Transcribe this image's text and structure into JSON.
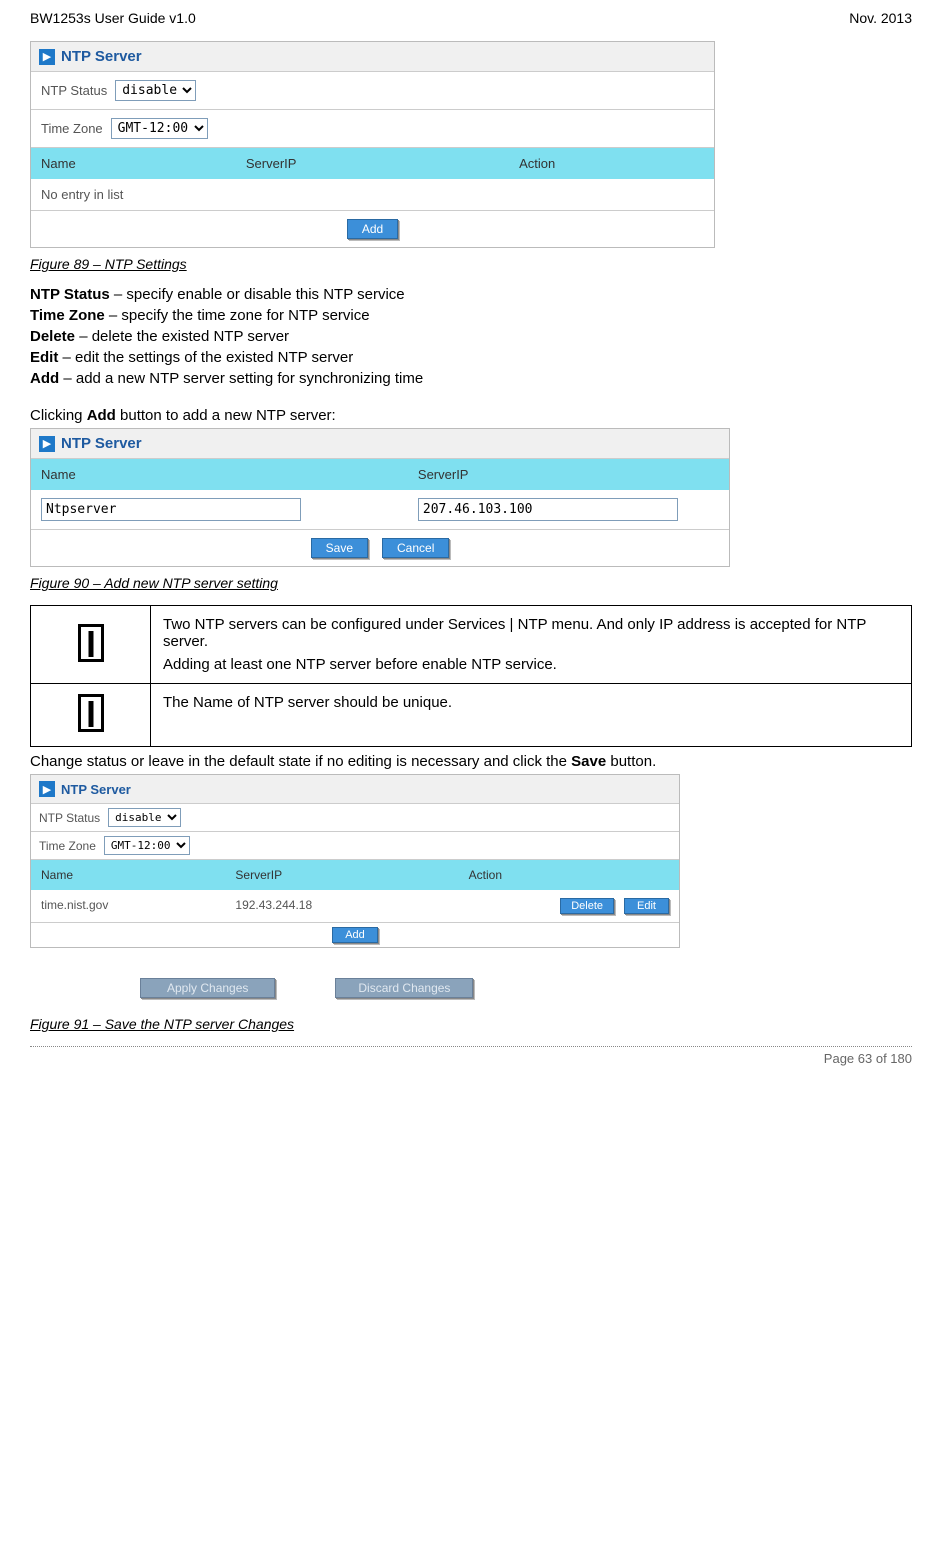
{
  "header": {
    "left": "BW1253s User Guide v1.0",
    "right": "Nov.  2013"
  },
  "panel1": {
    "title": "NTP Server",
    "ntp_status_label": "NTP Status",
    "ntp_status_value": "disable",
    "time_zone_label": "Time Zone",
    "time_zone_value": "GMT-12:00",
    "cols": {
      "name": "Name",
      "serverip": "ServerIP",
      "action": "Action"
    },
    "empty": "No entry in list",
    "add_btn": "Add"
  },
  "fig89": "Figure 89 – NTP Settings",
  "desc": {
    "ntp_status": {
      "k": "NTP Status",
      "v": " – specify enable or disable this NTP service"
    },
    "time_zone": {
      "k": "Time Zone",
      "v": " – specify the time zone for NTP service"
    },
    "delete": {
      "k": "Delete",
      "v": " – delete the existed NTP server"
    },
    "edit": {
      "k": "Edit",
      "v": " – edit the settings of the existed NTP server"
    },
    "add": {
      "k": "Add",
      "v": " – add a new NTP server setting for synchronizing time"
    }
  },
  "clicking_add": {
    "pre": "Clicking ",
    "b": "Add",
    "post": " button to add a new NTP server:"
  },
  "panel2": {
    "title": "NTP Server",
    "cols": {
      "name": "Name",
      "serverip": "ServerIP"
    },
    "name_value": "Ntpserver",
    "ip_value": "207.46.103.100",
    "save_btn": "Save",
    "cancel_btn": "Cancel"
  },
  "fig90": "Figure 90 – Add new NTP server setting",
  "notes": {
    "n1a": "Two NTP servers can be configured under ",
    "n1b": "Services | NTP ",
    "n1c": " menu. And only IP address is accepted for NTP server.",
    "n1d": "Adding at least one NTP server before enable NTP service.",
    "n2a": "The ",
    "n2b": "Name",
    "n2c": " of NTP server should be unique."
  },
  "change_para": {
    "pre": "Change status or leave in the default state if no editing is necessary and click the ",
    "b": "Save",
    "post": " button."
  },
  "panel3": {
    "title": "NTP Server",
    "ntp_status_label": "NTP Status",
    "ntp_status_value": "disable",
    "time_zone_label": "Time Zone",
    "time_zone_value": "GMT-12:00",
    "cols": {
      "name": "Name",
      "serverip": "ServerIP",
      "action": "Action"
    },
    "row": {
      "name": "time.nist.gov",
      "ip": "192.43.244.18"
    },
    "delete_btn": "Delete",
    "edit_btn": "Edit",
    "add_btn": "Add",
    "apply_btn": "Apply Changes",
    "discard_btn": "Discard Changes"
  },
  "fig91": "Figure 91 – Save the NTP server Changes",
  "footer": "Page 63 of 180"
}
